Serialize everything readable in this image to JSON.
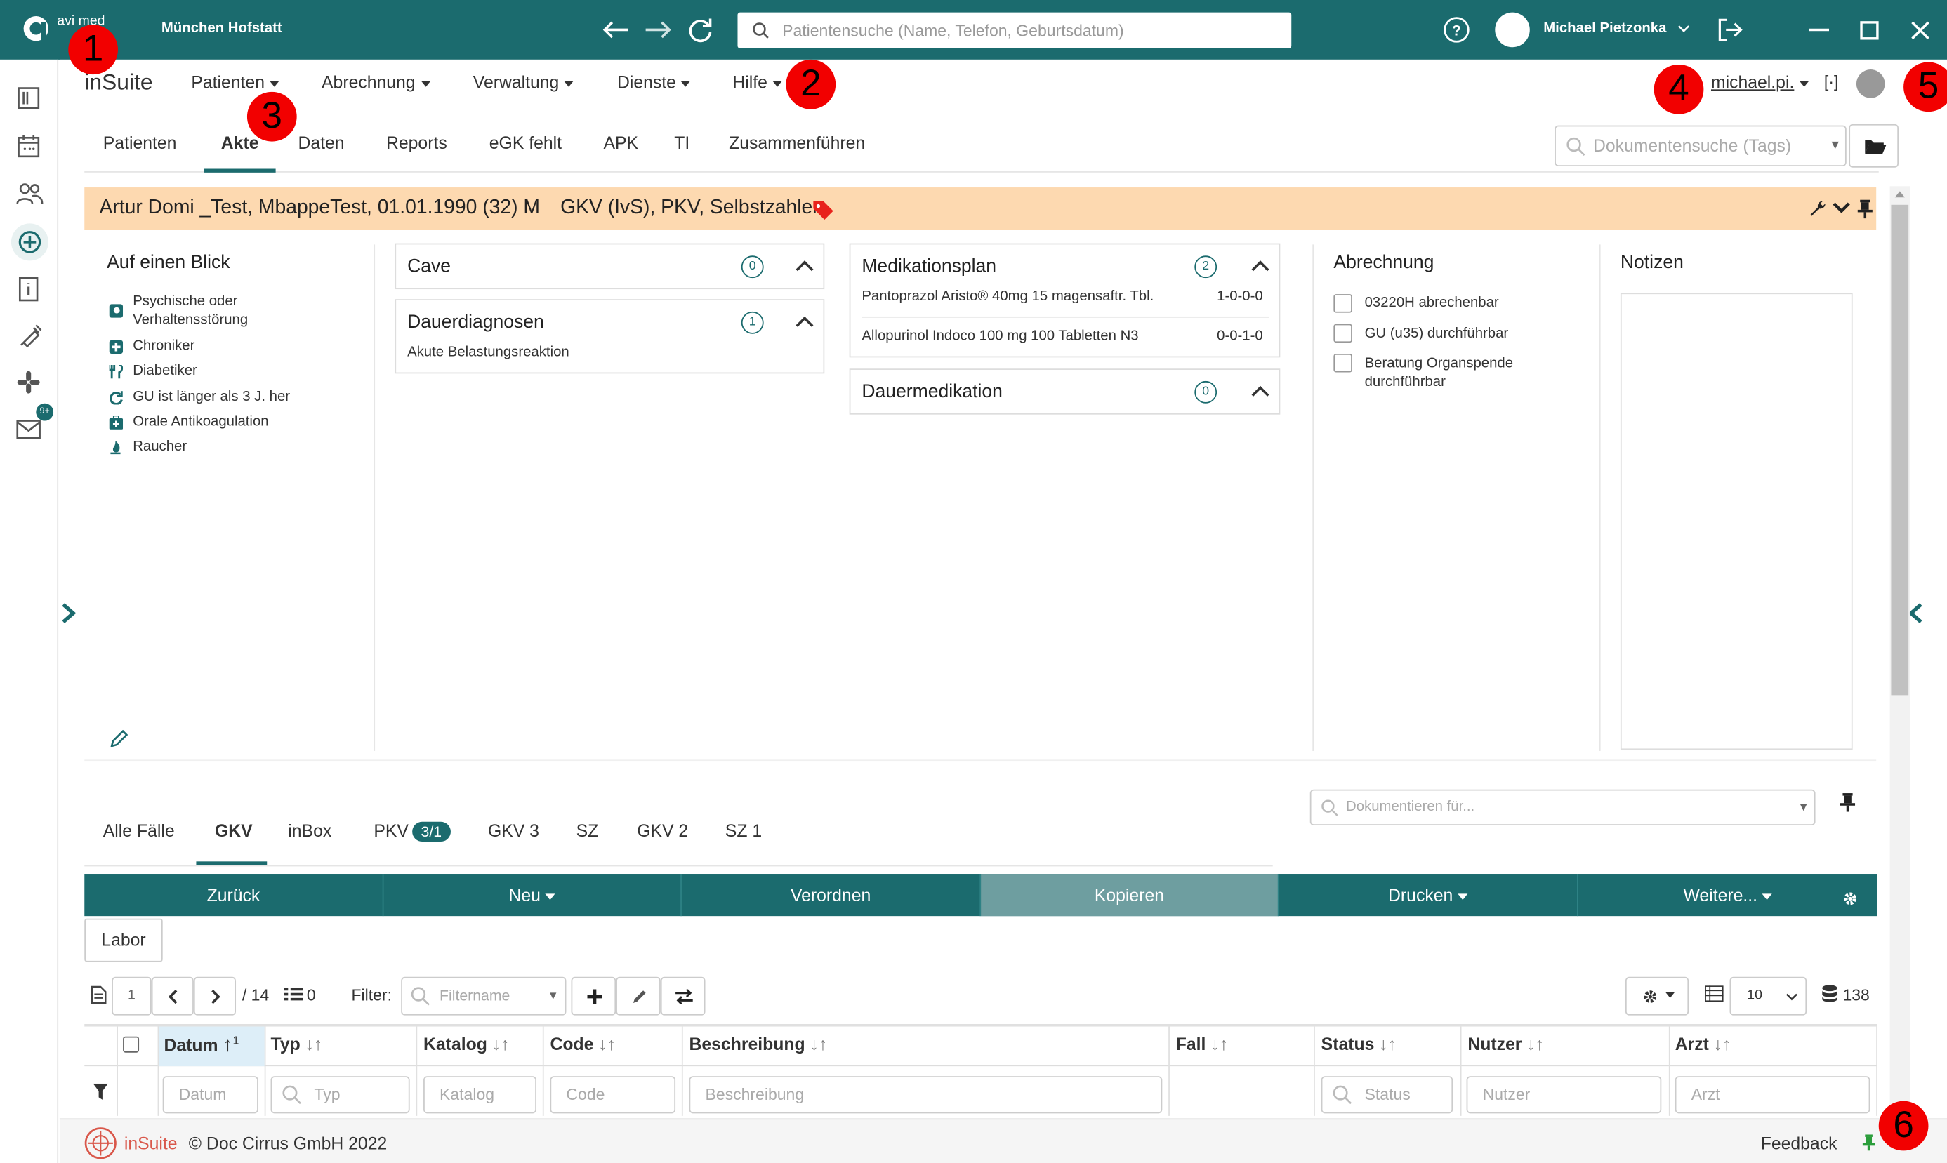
{
  "titlebar": {
    "logo_text": "avi med",
    "location": "München Hofstatt",
    "search_placeholder": "Patientensuche (Name, Telefon, Geburtsdatum)",
    "user_name": "Michael Pietzonka"
  },
  "sidebar": {
    "badge": "9+"
  },
  "menubar": {
    "brand": "inSuite",
    "items": [
      "Patienten",
      "Abrechnung",
      "Verwaltung",
      "Dienste",
      "Hilfe"
    ],
    "user_short": "michael.pi.",
    "bracket": "[·]"
  },
  "tabs": {
    "items": [
      "Patienten",
      "Akte",
      "Daten",
      "Reports",
      "eGK fehlt",
      "APK",
      "TI",
      "Zusammenführen"
    ],
    "active": "Akte",
    "doc_search_placeholder": "Dokumentensuche (Tags)"
  },
  "patient": {
    "header": "Artur Domi _Test, MbappeTest, 01.01.1990 (32) M",
    "insurance": "GKV (IvS), PKV, Selbstzahler"
  },
  "glance": {
    "title": "Auf einen Blick",
    "items": [
      {
        "label": "Psychische oder Verhaltensstörung",
        "icon": "head-icon"
      },
      {
        "label": "Chroniker",
        "icon": "plus-square-icon"
      },
      {
        "label": "Diabetiker",
        "icon": "fork-knife-icon"
      },
      {
        "label": "GU ist länger als 3 J. her",
        "icon": "refresh-icon"
      },
      {
        "label": "Orale Antikoagulation",
        "icon": "medkit-icon"
      },
      {
        "label": "Raucher",
        "icon": "flame-icon"
      }
    ]
  },
  "cave": {
    "title": "Cave",
    "count": "0"
  },
  "dauerdiagnosen": {
    "title": "Dauerdiagnosen",
    "count": "1",
    "items": [
      "Akute Belastungsreaktion"
    ]
  },
  "medikationsplan": {
    "title": "Medikationsplan",
    "count": "2",
    "items": [
      {
        "name": "Pantoprazol Aristo® 40mg 15 magensaftr. Tbl.",
        "dose": "1-0-0-0"
      },
      {
        "name": "Allopurinol Indoco 100 mg 100 Tabletten N3",
        "dose": "0-0-1-0"
      }
    ]
  },
  "dauermedikation": {
    "title": "Dauermedikation",
    "count": "0"
  },
  "abrechnung": {
    "title": "Abrechnung",
    "items": [
      "03220H abrechenbar",
      "GU (u35) durchführbar",
      "Beratung Organspende durchführbar"
    ]
  },
  "notizen": {
    "title": "Notizen"
  },
  "casetabs": {
    "items": [
      "Alle Fälle",
      "GKV",
      "inBox",
      "PKV",
      "GKV 3",
      "SZ",
      "GKV 2",
      "SZ 1"
    ],
    "active": "GKV",
    "pkv_badge": "3/1",
    "doc_for_placeholder": "Dokumentieren für..."
  },
  "actions": {
    "items": [
      "Zurück",
      "Neu",
      "Verordnen",
      "Kopieren",
      "Drucken",
      "Weitere..."
    ]
  },
  "labor": "Labor",
  "toolbar": {
    "page": "1",
    "pages": "/ 14",
    "selected": "0",
    "filter_label": "Filter:",
    "filter_placeholder": "Filtername",
    "page_size": "10",
    "total": "138"
  },
  "grid": {
    "columns": [
      "Datum",
      "Typ",
      "Katalog",
      "Code",
      "Beschreibung",
      "Fall",
      "Status",
      "Nutzer",
      "Arzt"
    ],
    "sort_index": "1",
    "filters": [
      "Datum",
      "Typ",
      "Katalog",
      "Code",
      "Beschreibung",
      "Status",
      "Nutzer",
      "Arzt"
    ]
  },
  "footer": {
    "brand": "inSuite",
    "copyright": "© Doc Cirrus GmbH 2022",
    "feedback": "Feedback"
  },
  "markers": [
    "1",
    "2",
    "3",
    "4",
    "5",
    "6"
  ],
  "colors": {
    "primary": "#1b6b6e",
    "patient_header": "#fdd9b0",
    "marker": "#f20000"
  }
}
